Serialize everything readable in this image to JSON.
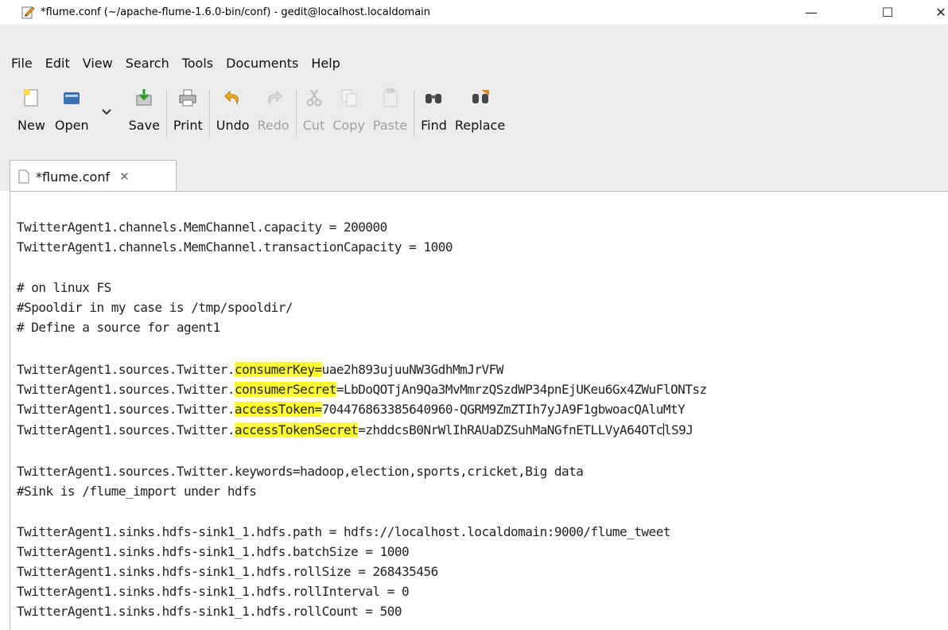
{
  "window": {
    "title": "*flume.conf (~/apache-flume-1.6.0-bin/conf) - gedit@localhost.localdomain",
    "controls": {
      "minimize": "—",
      "maximize": "☐",
      "close": "✕"
    }
  },
  "menu": [
    "File",
    "Edit",
    "View",
    "Search",
    "Tools",
    "Documents",
    "Help"
  ],
  "toolbar": {
    "new": "New",
    "open": "Open",
    "save": "Save",
    "print": "Print",
    "undo": "Undo",
    "redo": "Redo",
    "cut": "Cut",
    "copy": "Copy",
    "paste": "Paste",
    "find": "Find",
    "replace": "Replace"
  },
  "tab": {
    "label": "*flume.conf",
    "close": "✕"
  },
  "editor": {
    "lines": [
      "",
      "TwitterAgent1.channels.MemChannel.capacity = 200000",
      "TwitterAgent1.channels.MemChannel.transactionCapacity = 1000",
      "",
      "# on linux FS",
      "#Spooldir in my case is /tmp/spooldir/",
      "# Define a source for agent1",
      "",
      "",
      "",
      "",
      "",
      "",
      "TwitterAgent1.sources.Twitter.keywords=hadoop,election,sports,cricket,Big data",
      "#Sink is /flume_import under hdfs",
      "",
      "TwitterAgent1.sinks.hdfs-sink1_1.hdfs.path = hdfs://localhost.localdomain:9000/flume_tweet",
      "TwitterAgent1.sinks.hdfs-sink1_1.hdfs.batchSize = 1000",
      "TwitterAgent1.sinks.hdfs-sink1_1.hdfs.rollSize = 268435456",
      "TwitterAgent1.sinks.hdfs-sink1_1.hdfs.rollInterval = 0",
      "TwitterAgent1.sinks.hdfs-sink1_1.hdfs.rollCount = 500"
    ],
    "highlighted_lines": [
      {
        "prefix": "TwitterAgent1.sources.Twitter.",
        "key": "consumerKey=",
        "value": "uae2h893ujuuNW3GdhMmJrVFW"
      },
      {
        "prefix": "TwitterAgent1.sources.Twitter.",
        "key": "consumerSecret",
        "value": "=LbDoQOTjAn9Qa3MvMmrzQSzdWP34pnEjUKeu6Gx4ZWuFlONTsz"
      },
      {
        "prefix": "TwitterAgent1.sources.Twitter.",
        "key": "accessToken=",
        "value": "704476863385640960-QGRM9ZmZTIh7yJA9F1gbwoacQAluMtY"
      },
      {
        "prefix": "TwitterAgent1.sources.Twitter.",
        "key": "accessTokenSecret",
        "value_before_cursor": "=zhddcsB0NrWlIhRAUaDZSuhMaNGfnETLLVyA64OTc",
        "value_after_cursor": "lS9J"
      }
    ],
    "highlight_color": "#ffff33"
  }
}
